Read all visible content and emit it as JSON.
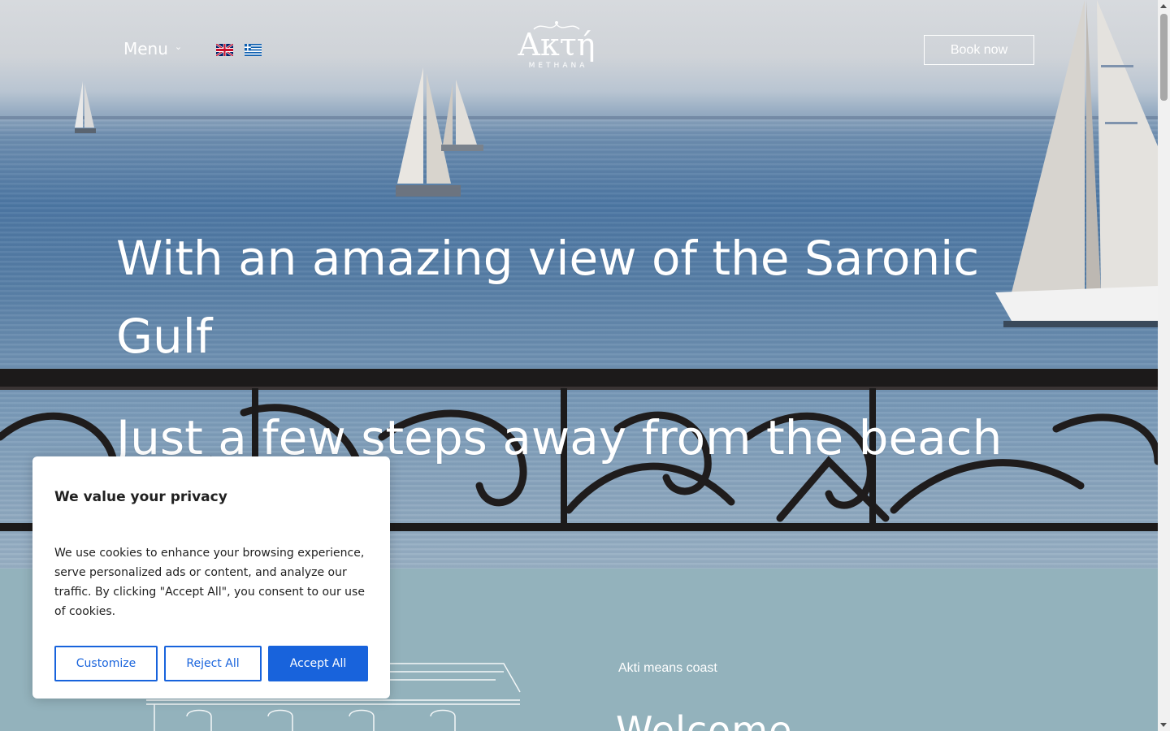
{
  "header": {
    "menu_label": "Menu",
    "book_label": "Book now",
    "languages": [
      "English",
      "Greek"
    ]
  },
  "logo": {
    "word": "Ακτή",
    "subtitle": "METHANA"
  },
  "hero": {
    "line1": "With an amazing view of the Saronic",
    "line2": "Gulf",
    "line3": "Just a few steps away from the beach"
  },
  "section2": {
    "kicker": "Akti means coast",
    "heading": "Welcome"
  },
  "cookie": {
    "title": "We value your privacy",
    "body": "We use cookies to enhance your browsing experience, serve personalized ads or content, and analyze our traffic. By clicking \"Accept All\", you consent to our use of cookies.",
    "customize_label": "Customize",
    "reject_label": "Reject All",
    "accept_label": "Accept All"
  },
  "colors": {
    "accent": "#1863dc",
    "section_bg": "#93b2bc",
    "text_dark": "#212121"
  }
}
